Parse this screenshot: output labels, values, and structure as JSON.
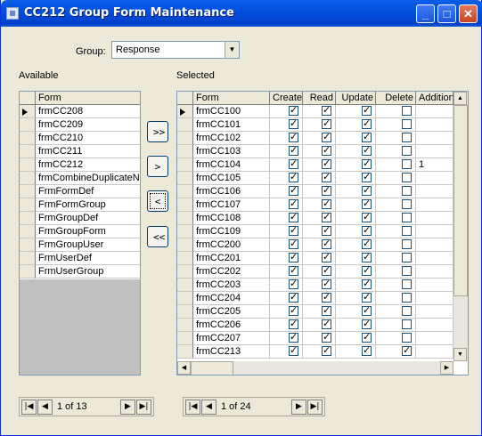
{
  "window": {
    "title": "CC212 Group Form Maintenance"
  },
  "group": {
    "label": "Group:",
    "value": "Response"
  },
  "available": {
    "label": "Available",
    "header": "Form",
    "rows": [
      "frmCC208",
      "frmCC209",
      "frmCC210",
      "frmCC211",
      "frmCC212",
      "frmCombineDuplicateNa",
      "FrmFormDef",
      "FrmFormGroup",
      "FrmGroupDef",
      "FrmGroupForm",
      "FrmGroupUser",
      "FrmUserDef",
      "FrmUserGroup"
    ],
    "nav": {
      "text": "1 of 13"
    }
  },
  "selected": {
    "label": "Selected",
    "headers": [
      "Form",
      "Create",
      "Read",
      "Update",
      "Delete",
      "Addition"
    ],
    "rows": [
      {
        "form": "frmCC100",
        "create": true,
        "read": true,
        "update": true,
        "delete": false,
        "addition": ""
      },
      {
        "form": "frmCC101",
        "create": true,
        "read": true,
        "update": true,
        "delete": false,
        "addition": ""
      },
      {
        "form": "frmCC102",
        "create": true,
        "read": true,
        "update": true,
        "delete": false,
        "addition": ""
      },
      {
        "form": "frmCC103",
        "create": true,
        "read": true,
        "update": true,
        "delete": false,
        "addition": ""
      },
      {
        "form": "frmCC104",
        "create": true,
        "read": true,
        "update": true,
        "delete": false,
        "addition": "1"
      },
      {
        "form": "frmCC105",
        "create": true,
        "read": true,
        "update": true,
        "delete": false,
        "addition": ""
      },
      {
        "form": "frmCC106",
        "create": true,
        "read": true,
        "update": true,
        "delete": false,
        "addition": ""
      },
      {
        "form": "frmCC107",
        "create": true,
        "read": true,
        "update": true,
        "delete": false,
        "addition": ""
      },
      {
        "form": "frmCC108",
        "create": true,
        "read": true,
        "update": true,
        "delete": false,
        "addition": ""
      },
      {
        "form": "frmCC109",
        "create": true,
        "read": true,
        "update": true,
        "delete": false,
        "addition": ""
      },
      {
        "form": "frmCC200",
        "create": true,
        "read": true,
        "update": true,
        "delete": false,
        "addition": ""
      },
      {
        "form": "frmCC201",
        "create": true,
        "read": true,
        "update": true,
        "delete": false,
        "addition": ""
      },
      {
        "form": "frmCC202",
        "create": true,
        "read": true,
        "update": true,
        "delete": false,
        "addition": ""
      },
      {
        "form": "frmCC203",
        "create": true,
        "read": true,
        "update": true,
        "delete": false,
        "addition": ""
      },
      {
        "form": "frmCC204",
        "create": true,
        "read": true,
        "update": true,
        "delete": false,
        "addition": ""
      },
      {
        "form": "frmCC205",
        "create": true,
        "read": true,
        "update": true,
        "delete": false,
        "addition": ""
      },
      {
        "form": "frmCC206",
        "create": true,
        "read": true,
        "update": true,
        "delete": false,
        "addition": ""
      },
      {
        "form": "frmCC207",
        "create": true,
        "read": true,
        "update": true,
        "delete": false,
        "addition": ""
      },
      {
        "form": "frmCC213",
        "create": true,
        "read": true,
        "update": true,
        "delete": true,
        "addition": ""
      }
    ],
    "nav": {
      "text": "1 of 24"
    }
  },
  "buttons": {
    "add_all": ">>",
    "add_one": ">",
    "remove_one": "<",
    "remove_all": "<<"
  }
}
